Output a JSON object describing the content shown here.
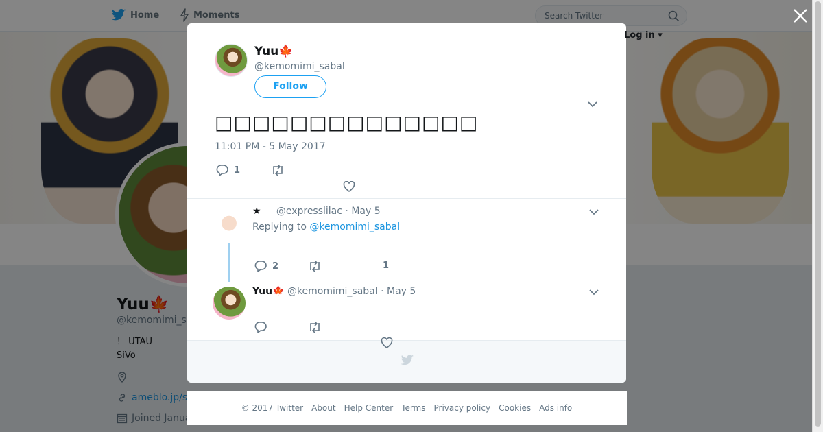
{
  "nav": {
    "home_label": "Home",
    "moments_label": "Moments",
    "search_placeholder": "Search Twitter",
    "login_label": "Log in"
  },
  "profile": {
    "name": "Yuu🍁",
    "handle": "@kemomimi_sa",
    "bio_line1": "！ UTAU",
    "bio_line2": "SiVo",
    "website": "ameblo.jp/s",
    "joined": "Joined Janua"
  },
  "tweet": {
    "author_name": "Yuu🍁",
    "author_handle": "@kemomimi_sabal",
    "follow_label": "Follow",
    "text": "□□□□□□□□□□□□□□",
    "timestamp": "11:01 PM - 5 May 2017",
    "reply_count": "1",
    "retweet_count": "",
    "like_count": ""
  },
  "replies": [
    {
      "name": "★",
      "handle": "@expresslilac",
      "date": "· May 5",
      "replying_prefix": "Replying to ",
      "replying_handle": "@kemomimi_sabal",
      "reply_count": "2",
      "retweet_count": "",
      "like_count": "1"
    },
    {
      "name": "Yuu🍁",
      "handle": "@kemomimi_sabal",
      "date": "· May 5",
      "reply_count": "",
      "retweet_count": "",
      "like_count": ""
    }
  ],
  "footer": {
    "links": [
      "© 2017 Twitter",
      "About",
      "Help Center",
      "Terms",
      "Privacy policy",
      "Cookies",
      "Ads info"
    ]
  },
  "colors": {
    "accent": "#1da1f2",
    "link": "#1b95e0",
    "muted": "#657786"
  },
  "icons": [
    "twitter-bird-icon",
    "lightning-icon",
    "search-icon",
    "close-icon",
    "chevron-down-icon",
    "reply-icon",
    "retweet-icon",
    "heart-icon",
    "location-icon",
    "link-icon",
    "calendar-icon"
  ]
}
